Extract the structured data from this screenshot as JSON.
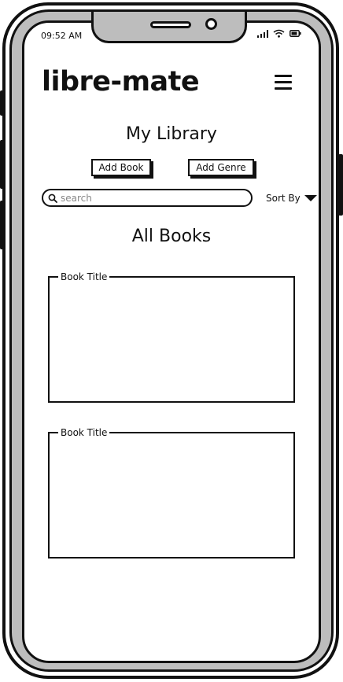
{
  "status_bar": {
    "time": "09:52 AM",
    "icons": [
      "signal-icon",
      "wifi-icon",
      "battery-icon"
    ]
  },
  "header": {
    "app_title": "libre-mate",
    "menu_icon": "hamburger-menu-icon"
  },
  "library": {
    "title": "My Library",
    "add_book_label": "Add Book",
    "add_genre_label": "Add Genre"
  },
  "search": {
    "placeholder": "search",
    "icon": "search-icon"
  },
  "sort": {
    "label": "Sort By",
    "icon": "caret-down-icon"
  },
  "books": {
    "section_title": "All Books",
    "items": [
      {
        "title": "Book Title"
      },
      {
        "title": "Book Title"
      }
    ]
  },
  "colors": {
    "stroke": "#111111",
    "frame_band": "#bdbdbd",
    "background": "#ffffff"
  }
}
